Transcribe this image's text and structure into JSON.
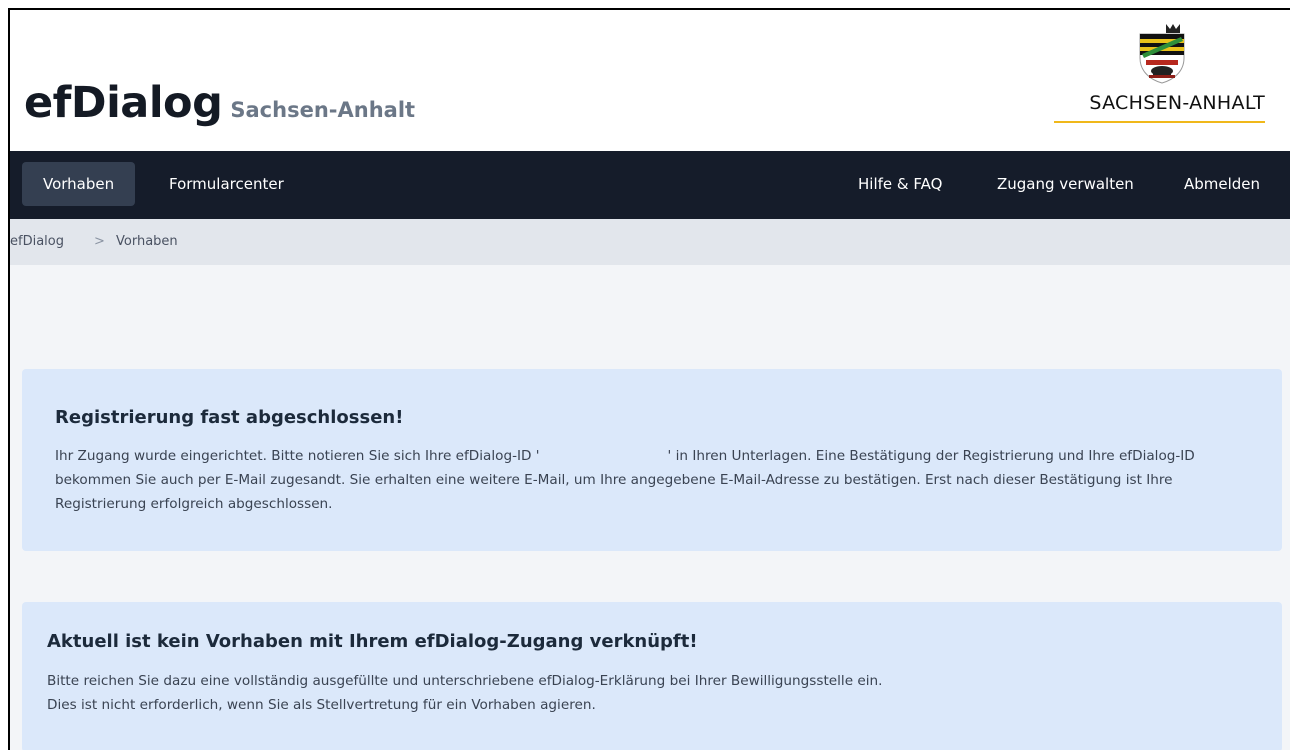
{
  "header": {
    "brand_name": "efDialog",
    "brand_sub": "Sachsen-Anhalt",
    "logo_text": "SACHSEN-ANHALT",
    "colors": {
      "accent_line": "#f0b81a",
      "nav_bg": "#151c2a",
      "alert_bg": "#dbe8fa"
    }
  },
  "nav": {
    "left": [
      {
        "label": "Vorhaben",
        "active": true
      },
      {
        "label": "Formularcenter",
        "active": false
      }
    ],
    "right": [
      {
        "label": "Hilfe & FAQ"
      },
      {
        "label": "Zugang verwalten"
      },
      {
        "label": "Abmelden"
      }
    ]
  },
  "breadcrumb": {
    "items": [
      "efDialog",
      "Vorhaben"
    ],
    "separator": ">"
  },
  "alert_registration": {
    "title": "Registrierung fast abgeschlossen!",
    "text_before_id": "Ihr Zugang wurde eingerichtet. Bitte notieren Sie sich Ihre efDialog-ID '",
    "text_after_id": "' in Ihren Unterlagen. Eine Bestätigung der Registrierung und Ihre efDialog-ID bekommen Sie auch per E-Mail zugesandt. Sie erhalten eine weitere E-Mail, um Ihre angegebene E-Mail-Adresse zu bestätigen. Erst nach dieser Bestätigung ist Ihre Registrierung erfolgreich abgeschlossen."
  },
  "alert_no_project": {
    "title": "Aktuell ist kein Vorhaben mit Ihrem efDialog-Zugang verknüpft!",
    "line1": "Bitte reichen Sie dazu eine vollständig ausgefüllte und unterschriebene efDialog-Erklärung bei Ihrer Bewilligungsstelle ein.",
    "line2": "Dies ist nicht erforderlich, wenn Sie als Stellvertretung für ein Vorhaben agieren."
  }
}
